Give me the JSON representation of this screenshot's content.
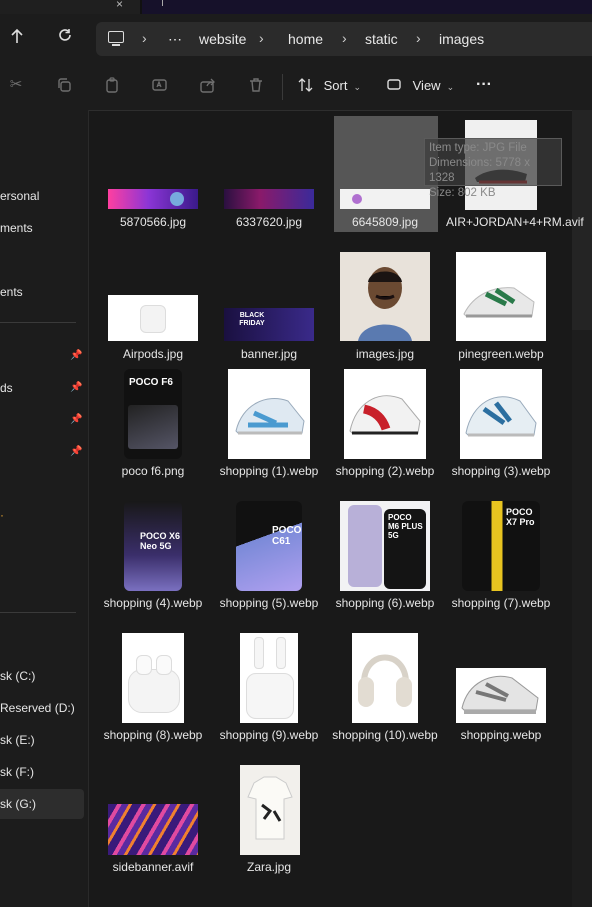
{
  "window": {
    "tab_close": "×"
  },
  "nav": {
    "up_icon": "arrow-up-icon",
    "refresh_icon": "refresh-icon",
    "more": "⋯",
    "breadcrumb": [
      "website",
      "home",
      "static",
      "images"
    ]
  },
  "toolbar": {
    "sort_label": "Sort",
    "view_label": "View",
    "more_label": "···"
  },
  "sidebar": {
    "items": [
      {
        "label": "ersonal"
      },
      {
        "label": "ments"
      },
      {
        "label": "ents"
      },
      {
        "label": "ds"
      }
    ],
    "orange_glyph": "·",
    "drives": [
      {
        "label": "sk (C:)"
      },
      {
        "label": "Reserved (D:)"
      },
      {
        "label": "sk (E:)"
      },
      {
        "label": "sk (F:)"
      },
      {
        "label": "sk (G:)"
      }
    ]
  },
  "tooltip": {
    "type": "Item type: JPG File",
    "dimensions": "Dimensions: 5778 x 1328",
    "size": "Size: 802 KB"
  },
  "files": [
    {
      "name": "5870566.jpg"
    },
    {
      "name": "6337620.jpg"
    },
    {
      "name": "6645809.jpg"
    },
    {
      "name": "AIR+JORDAN+4+RM.avif"
    },
    {
      "name": "Airpods.jpg"
    },
    {
      "name": "banner.jpg"
    },
    {
      "name": "images.jpg"
    },
    {
      "name": "pinegreen.webp"
    },
    {
      "name": "poco f6.png"
    },
    {
      "name": "shopping (1).webp"
    },
    {
      "name": "shopping (2).webp"
    },
    {
      "name": "shopping (3).webp"
    },
    {
      "name": "shopping (4).webp"
    },
    {
      "name": "shopping (5).webp"
    },
    {
      "name": "shopping (6).webp"
    },
    {
      "name": "shopping (7).webp"
    },
    {
      "name": "shopping (8).webp"
    },
    {
      "name": "shopping (9).webp"
    },
    {
      "name": "shopping (10).webp"
    },
    {
      "name": "shopping.webp"
    },
    {
      "name": "sidebanner.avif"
    },
    {
      "name": "Zara.jpg"
    }
  ],
  "thumb_text": {
    "poco_f6": "POCO F6",
    "poco_x6": "POCO X6 Neo 5G",
    "poco_c61": "POCO C61",
    "poco_m6": "POCO M6 PLUS 5G",
    "poco_x7": "POCO X7 Pro",
    "black_friday": "BLACK FRIDAY"
  }
}
